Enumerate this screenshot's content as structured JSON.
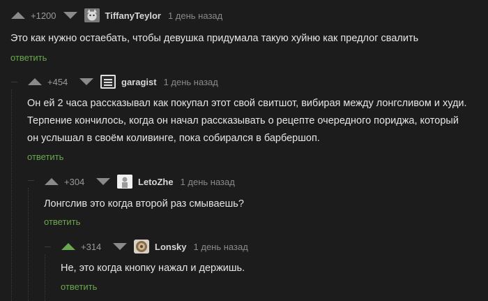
{
  "comments": [
    {
      "rating": "+1200",
      "username": "TiffanyTeylor",
      "time": "1 день назад",
      "text": "Это как нужно остаебать, чтобы девушка придумала такую хуйню как предлог свалить",
      "reply": "ответить",
      "avatar_icon": "cat-avatar-icon"
    },
    {
      "rating": "+454",
      "username": "garagist",
      "time": "1 день назад",
      "text_lines": [
        "Он ей 2 часа рассказывал как покупал этот свой свитшот, вибирая между лонгсливом и худи.",
        "Терпение кончилось, когда он начал рассказывать о рецепте очередного пориджа, который",
        "он услышал в своём коливинге, пока собирался в барбершоп."
      ],
      "reply": "ответить",
      "avatar_icon": "garage-avatar-icon"
    },
    {
      "rating": "+304",
      "username": "LetoZhe",
      "time": "1 день назад",
      "text": "Лонгслив это когда второй раз смываешь?",
      "reply": "ответить",
      "avatar_icon": "person-avatar-icon"
    },
    {
      "rating": "+314",
      "username": "Lonsky",
      "time": "1 день назад",
      "text": "Не, это когда кнопку нажал и держишь.",
      "reply": "ответить",
      "avatar_icon": "round-avatar-icon"
    }
  ],
  "colors": {
    "background": "#1c1c1c",
    "accent_green": "#6aa84f",
    "muted": "#8a8a8a"
  }
}
